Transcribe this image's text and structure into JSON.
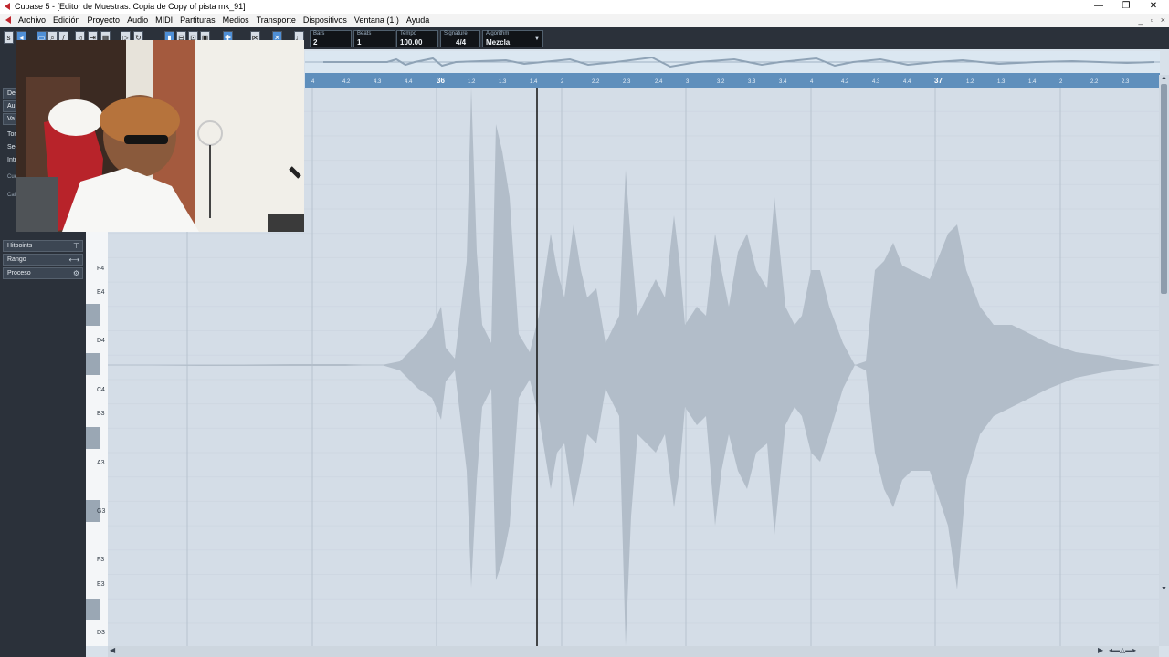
{
  "window": {
    "title": "Cubase 5 - [Editor de Muestras: Copia de Copy of pista mk_91]"
  },
  "menu": {
    "items": [
      "Archivo",
      "Edición",
      "Proyecto",
      "Audio",
      "MIDI",
      "Partituras",
      "Medios",
      "Transporte",
      "Dispositivos",
      "Ventana (1.)",
      "Ayuda"
    ]
  },
  "toolbar": {
    "bars": {
      "label": "Bars",
      "value": "2"
    },
    "beats": {
      "label": "Beats",
      "value": "1"
    },
    "tempo": {
      "label": "Tempo",
      "value": "100.00"
    },
    "signature": {
      "label": "Signature",
      "value": "4/4"
    },
    "algorithm": {
      "label": "Algorithm",
      "value": "Mezcla"
    }
  },
  "inspector": {
    "hidden_labels": [
      "De",
      "Au",
      "Va",
      "Tor",
      "Seg",
      "Intro",
      "Cue",
      "Cal"
    ],
    "funciones_label": "Funciones",
    "hitpoints": "Hitpoints",
    "rango": "Rango",
    "proceso": "Proceso"
  },
  "ruler": {
    "bar_36": "36",
    "bar_37": "37",
    "ticks": [
      "4",
      "4.2",
      "4.3",
      "4.4",
      "1.2",
      "1.3",
      "1.4",
      "2",
      "2.2",
      "2.3",
      "2.4",
      "3",
      "3.2",
      "3.3",
      "3.4",
      "4",
      "4.2",
      "4.3",
      "4.4",
      "1.2",
      "1.3",
      "1.4",
      "2",
      "2.2",
      "2.3"
    ]
  },
  "piano_labels": [
    "F4",
    "E4",
    "D4",
    "C4",
    "B3",
    "A3",
    "G3",
    "F3",
    "E3",
    "D3"
  ],
  "colors": {
    "waveform": "#b2bdc9",
    "ruler": "#5f8fbc",
    "editor_bg": "#ccd6e1",
    "toolbar_bg": "#2b313a",
    "accent": "#4f8fd6"
  }
}
